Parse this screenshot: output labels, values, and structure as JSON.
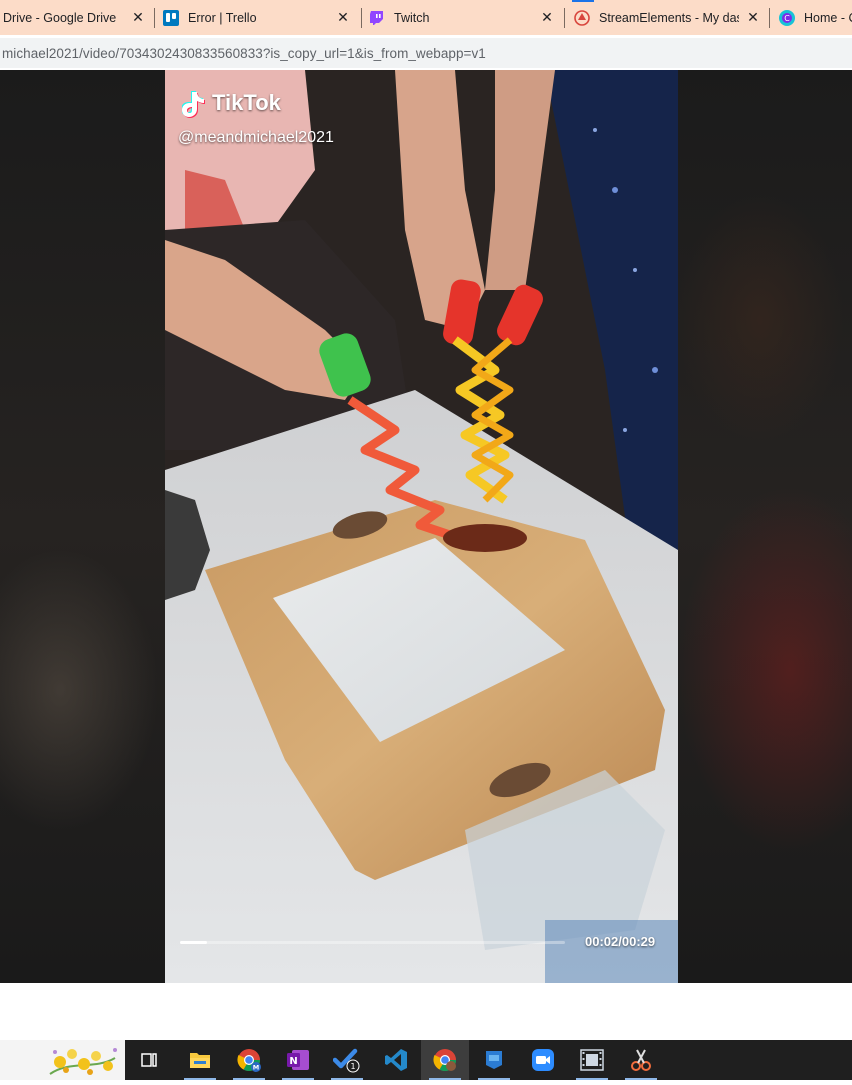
{
  "browser": {
    "tabs": [
      {
        "title": "Drive - Google Drive",
        "icon": "google-drive-icon",
        "closable": true
      },
      {
        "title": "Error | Trello",
        "icon": "trello-icon",
        "closable": true
      },
      {
        "title": "Twitch",
        "icon": "twitch-icon",
        "closable": true
      },
      {
        "title": "StreamElements - My dashboard",
        "icon": "streamelements-icon",
        "closable": true
      },
      {
        "title": "Home - Canva",
        "icon": "canva-icon",
        "closable": false
      }
    ],
    "url": "michael2021/video/7034302430833560833?is_copy_url=1&is_from_webapp=v1"
  },
  "video": {
    "brand": "TikTok",
    "handle": "@meandmichael2021",
    "time": "00:02/00:29",
    "progress": 0.07
  },
  "taskbar": {
    "apps": [
      {
        "name": "task-view-icon"
      },
      {
        "name": "file-explorer-icon"
      },
      {
        "name": "chrome-profile-m-icon"
      },
      {
        "name": "onenote-icon"
      },
      {
        "name": "todo-icon",
        "badge": "1"
      },
      {
        "name": "vscode-icon"
      },
      {
        "name": "chrome-icon"
      },
      {
        "name": "store-app-icon"
      },
      {
        "name": "zoom-icon"
      },
      {
        "name": "video-editor-icon"
      },
      {
        "name": "snipping-tool-icon"
      }
    ]
  },
  "colors": {
    "tabbar": "#fcdcc8",
    "accent": "#1a73e8",
    "taskbar": "#1f1f1f"
  }
}
